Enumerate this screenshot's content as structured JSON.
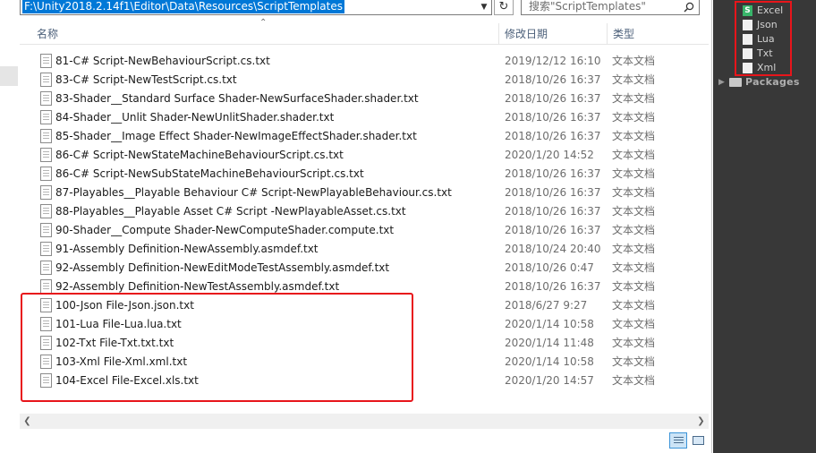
{
  "explorer": {
    "address_path": "F:\\Unity2018.2.14f1\\Editor\\Data\\Resources\\ScriptTemplates",
    "search_placeholder": "搜索\"ScriptTemplates\"",
    "columns": {
      "name": "名称",
      "date": "修改日期",
      "type": "类型"
    },
    "files": [
      {
        "name": "81-C# Script-NewBehaviourScript.cs.txt",
        "date": "2019/12/12 16:10",
        "type": "文本文档"
      },
      {
        "name": "83-C# Script-NewTestScript.cs.txt",
        "date": "2018/10/26 16:37",
        "type": "文本文档"
      },
      {
        "name": "83-Shader__Standard Surface Shader-NewSurfaceShader.shader.txt",
        "date": "2018/10/26 16:37",
        "type": "文本文档"
      },
      {
        "name": "84-Shader__Unlit Shader-NewUnlitShader.shader.txt",
        "date": "2018/10/26 16:37",
        "type": "文本文档"
      },
      {
        "name": "85-Shader__Image Effect Shader-NewImageEffectShader.shader.txt",
        "date": "2018/10/26 16:37",
        "type": "文本文档"
      },
      {
        "name": "86-C# Script-NewStateMachineBehaviourScript.cs.txt",
        "date": "2020/1/20 14:52",
        "type": "文本文档"
      },
      {
        "name": "86-C# Script-NewSubStateMachineBehaviourScript.cs.txt",
        "date": "2018/10/26 16:37",
        "type": "文本文档"
      },
      {
        "name": "87-Playables__Playable Behaviour C# Script-NewPlayableBehaviour.cs.txt",
        "date": "2018/10/26 16:37",
        "type": "文本文档"
      },
      {
        "name": "88-Playables__Playable Asset C# Script -NewPlayableAsset.cs.txt",
        "date": "2018/10/26 16:37",
        "type": "文本文档"
      },
      {
        "name": "90-Shader__Compute Shader-NewComputeShader.compute.txt",
        "date": "2018/10/26 16:37",
        "type": "文本文档"
      },
      {
        "name": "91-Assembly Definition-NewAssembly.asmdef.txt",
        "date": "2018/10/24 20:40",
        "type": "文本文档"
      },
      {
        "name": "92-Assembly Definition-NewEditModeTestAssembly.asmdef.txt",
        "date": "2018/10/26 0:47",
        "type": "文本文档"
      },
      {
        "name": "92-Assembly Definition-NewTestAssembly.asmdef.txt",
        "date": "2018/10/26 16:37",
        "type": "文本文档"
      },
      {
        "name": "100-Json File-Json.json.txt",
        "date": "2018/6/27 9:27",
        "type": "文本文档"
      },
      {
        "name": "101-Lua File-Lua.lua.txt",
        "date": "2020/1/14 10:58",
        "type": "文本文档"
      },
      {
        "name": "102-Txt File-Txt.txt.txt",
        "date": "2020/1/14 11:48",
        "type": "文本文档"
      },
      {
        "name": "103-Xml File-Xml.xml.txt",
        "date": "2020/1/14 10:58",
        "type": "文本文档"
      },
      {
        "name": "104-Excel File-Excel.xls.txt",
        "date": "2020/1/20 14:57",
        "type": "文本文档"
      }
    ]
  },
  "unity": {
    "assets": [
      {
        "label": "Excel",
        "icon": "script-icon"
      },
      {
        "label": "Json",
        "icon": "text-asset-icon"
      },
      {
        "label": "Lua",
        "icon": "text-asset-icon"
      },
      {
        "label": "Txt",
        "icon": "text-asset-icon"
      },
      {
        "label": "Xml",
        "icon": "text-asset-icon"
      }
    ],
    "packages_label": "Packages",
    "script_glyph": "S"
  },
  "colors": {
    "highlight": "#e8151b",
    "selection": "#0078d7",
    "unity_bg": "#383838"
  }
}
